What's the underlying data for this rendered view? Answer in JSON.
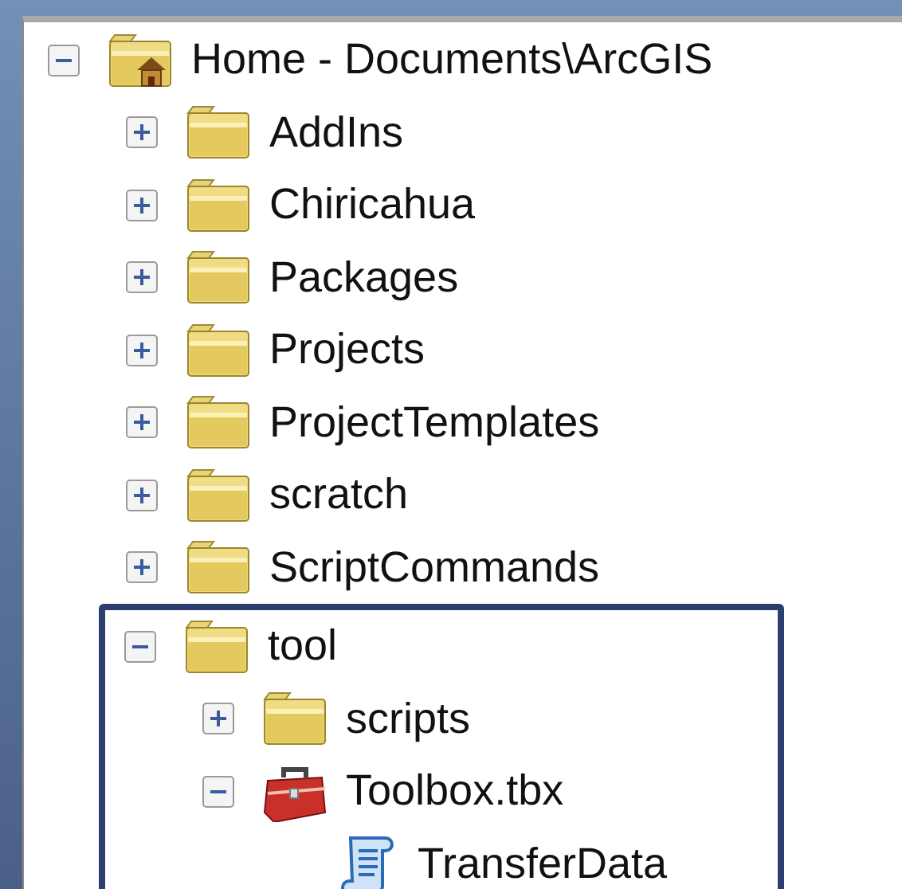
{
  "tree": [
    {
      "label": "Home - Documents\\ArcGIS",
      "kind": "home-folder",
      "expanded": true,
      "highlighted": false,
      "children": [
        {
          "label": "AddIns",
          "kind": "folder",
          "expanded": false,
          "highlighted": false
        },
        {
          "label": "Chiricahua",
          "kind": "folder",
          "expanded": false,
          "highlighted": false
        },
        {
          "label": "Packages",
          "kind": "folder",
          "expanded": false,
          "highlighted": false
        },
        {
          "label": "Projects",
          "kind": "folder",
          "expanded": false,
          "highlighted": false
        },
        {
          "label": "ProjectTemplates",
          "kind": "folder",
          "expanded": false,
          "highlighted": false
        },
        {
          "label": "scratch",
          "kind": "folder",
          "expanded": false,
          "highlighted": false
        },
        {
          "label": "ScriptCommands",
          "kind": "folder",
          "expanded": false,
          "highlighted": false
        },
        {
          "label": "tool",
          "kind": "folder",
          "expanded": true,
          "highlighted": true,
          "children": [
            {
              "label": "scripts",
              "kind": "folder",
              "expanded": false,
              "highlighted": false
            },
            {
              "label": "Toolbox.tbx",
              "kind": "toolbox",
              "expanded": true,
              "highlighted": false,
              "children": [
                {
                  "label": "TransferData",
                  "kind": "script",
                  "highlighted": false
                }
              ]
            }
          ]
        }
      ]
    }
  ]
}
